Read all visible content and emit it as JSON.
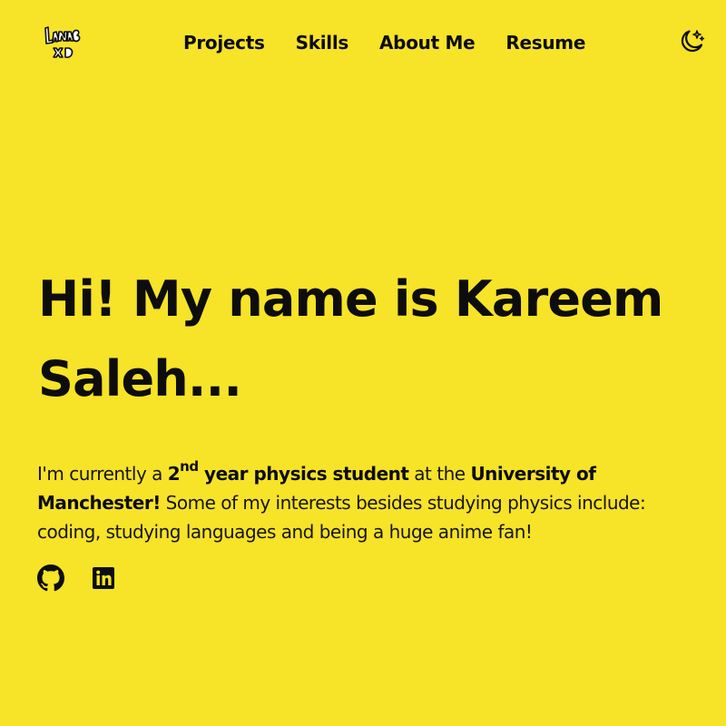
{
  "colors": {
    "background": "#f7e328",
    "text": "#0d0d0d"
  },
  "header": {
    "logo_icon": "kareem-signature-logo",
    "nav": [
      {
        "label": "Projects"
      },
      {
        "label": "Skills"
      },
      {
        "label": "About Me"
      },
      {
        "label": "Resume"
      }
    ],
    "theme_toggle_icon": "moon-stars-icon"
  },
  "hero": {
    "heading_line1": "Hi! My name is Kareem",
    "heading_line2": "Saleh...",
    "bio": {
      "intro": "I'm currently a ",
      "year_number": "2",
      "year_suffix": "nd",
      "role": " year physics student",
      "mid": " at the ",
      "university": "University of Manchester!",
      "rest": " Some of my interests besides studying physics include: coding, studying languages and being a huge anime fan!"
    }
  },
  "socials": [
    {
      "icon": "github-icon"
    },
    {
      "icon": "linkedin-icon"
    }
  ]
}
